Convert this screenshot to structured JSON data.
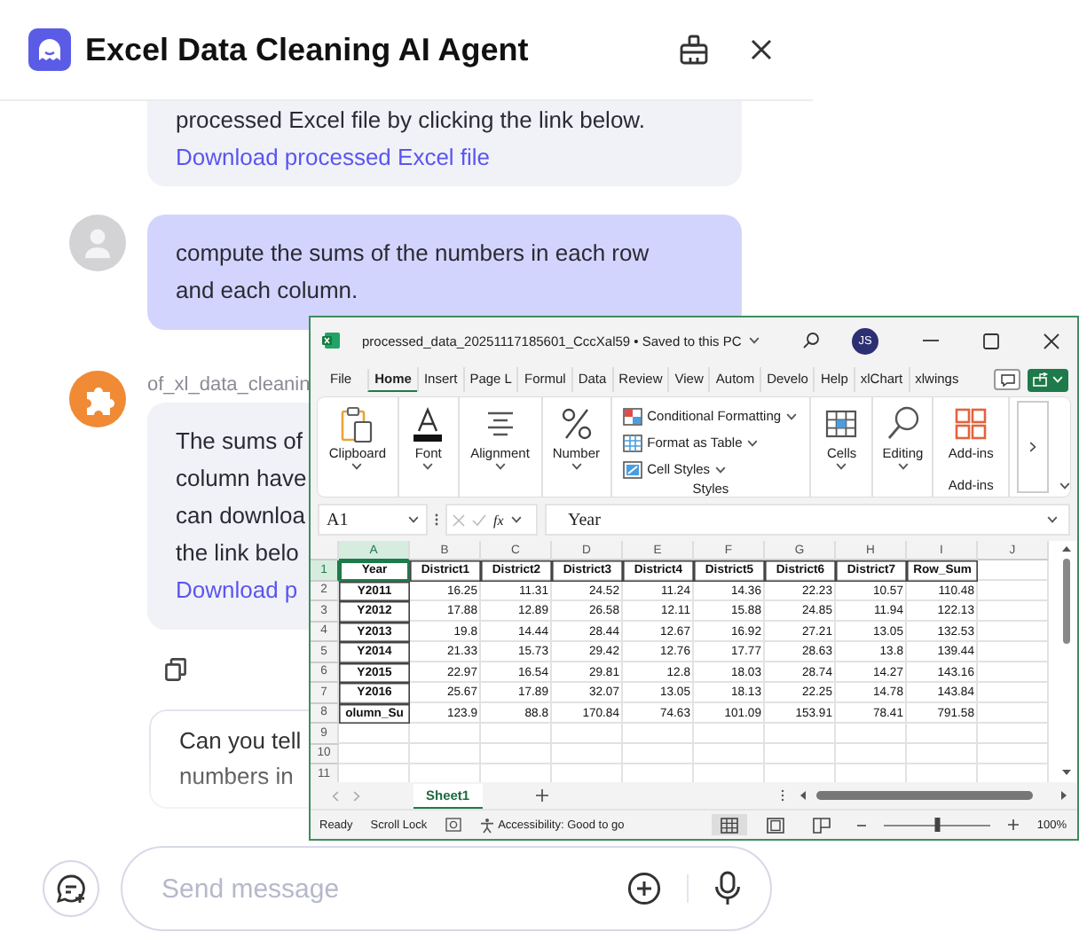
{
  "header": {
    "title": "Excel Data Cleaning AI Agent"
  },
  "messages": [
    {
      "kind": "bot",
      "text": "processed Excel file by clicking the link below.",
      "link": "Download processed Excel file"
    },
    {
      "kind": "user",
      "text": "compute the sums of the numbers in each row\nand each column."
    },
    {
      "kind": "bot",
      "sender": "of_xl_data_cleanin",
      "text": "The sums of\ncolumn have\ncan downloa\nthe link belo",
      "link": "Download p"
    }
  ],
  "suggestion": {
    "text": "Can you tell\nnumbers in"
  },
  "composer": {
    "placeholder": "Send message"
  },
  "excel": {
    "file_title": "processed_data_20251117185601_CccXal59 • Saved to this PC",
    "user_initials": "JS",
    "tabs": [
      {
        "label": "File",
        "selected": false
      },
      {
        "label": "Home",
        "selected": true
      },
      {
        "label": "Insert",
        "selected": false
      },
      {
        "label": "Page L",
        "selected": false
      },
      {
        "label": "Formul",
        "selected": false
      },
      {
        "label": "Data",
        "selected": false
      },
      {
        "label": "Review",
        "selected": false
      },
      {
        "label": "View",
        "selected": false
      },
      {
        "label": "Autom",
        "selected": false
      },
      {
        "label": "Develo",
        "selected": false
      },
      {
        "label": "Help",
        "selected": false
      },
      {
        "label": "xlChart",
        "selected": false
      },
      {
        "label": "xlwings",
        "selected": false
      }
    ],
    "ribbon": [
      {
        "kind": "clipboard",
        "label": "Clipboard"
      },
      {
        "kind": "font",
        "label": "Font"
      },
      {
        "kind": "alignment",
        "label": "Alignment"
      },
      {
        "kind": "number",
        "label": "Number"
      },
      {
        "kind": "styles",
        "group_label": "Styles",
        "items": [
          {
            "kind": "conditional",
            "label": "Conditional Formatting"
          },
          {
            "kind": "table",
            "label": "Format as Table"
          },
          {
            "kind": "cell-styles",
            "label": "Cell Styles"
          }
        ]
      },
      {
        "kind": "cells",
        "label": "Cells"
      },
      {
        "kind": "editing",
        "label": "Editing"
      },
      {
        "kind": "addins",
        "label": "Add-ins",
        "group_label": "Add-ins"
      }
    ],
    "name_box": "A1",
    "formula_label": "fx",
    "formula": "Year",
    "columns": [
      {
        "letter": "A",
        "selected": true
      },
      {
        "letter": "B",
        "selected": false
      },
      {
        "letter": "C",
        "selected": false
      },
      {
        "letter": "D",
        "selected": false
      },
      {
        "letter": "E",
        "selected": false
      },
      {
        "letter": "F",
        "selected": false
      },
      {
        "letter": "G",
        "selected": false
      },
      {
        "letter": "H",
        "selected": false
      },
      {
        "letter": "I",
        "selected": false
      },
      {
        "letter": "J",
        "selected": false
      }
    ],
    "rows": [
      {
        "number": "1",
        "selected": true,
        "cells": [
          "Year",
          "District1",
          "District2",
          "District3",
          "District4",
          "District5",
          "District6",
          "District7",
          "Row_Sum"
        ]
      },
      {
        "number": "2",
        "selected": false,
        "cells": [
          "Y2011",
          "16.25",
          "11.31",
          "24.52",
          "11.24",
          "14.36",
          "22.23",
          "10.57",
          "110.48"
        ]
      },
      {
        "number": "3",
        "selected": false,
        "cells": [
          "Y2012",
          "17.88",
          "12.89",
          "26.58",
          "12.11",
          "15.88",
          "24.85",
          "11.94",
          "122.13"
        ]
      },
      {
        "number": "4",
        "selected": false,
        "cells": [
          "Y2013",
          "19.8",
          "14.44",
          "28.44",
          "12.67",
          "16.92",
          "27.21",
          "13.05",
          "132.53"
        ]
      },
      {
        "number": "5",
        "selected": false,
        "cells": [
          "Y2014",
          "21.33",
          "15.73",
          "29.42",
          "12.76",
          "17.77",
          "28.63",
          "13.8",
          "139.44"
        ]
      },
      {
        "number": "6",
        "selected": false,
        "cells": [
          "Y2015",
          "22.97",
          "16.54",
          "29.81",
          "12.8",
          "18.03",
          "28.74",
          "14.27",
          "143.16"
        ]
      },
      {
        "number": "7",
        "selected": false,
        "cells": [
          "Y2016",
          "25.67",
          "17.89",
          "32.07",
          "13.05",
          "18.13",
          "22.25",
          "14.78",
          "143.84"
        ]
      },
      {
        "number": "8",
        "selected": false,
        "cells": [
          "olumn_Su",
          "123.9",
          "88.8",
          "170.84",
          "74.63",
          "101.09",
          "153.91",
          "78.41",
          "791.58"
        ]
      },
      {
        "number": "9",
        "selected": false
      },
      {
        "number": "10",
        "selected": false
      },
      {
        "number": "11",
        "selected": false
      }
    ],
    "sheet_tabs": [
      {
        "label": "Sheet1",
        "selected": true
      }
    ],
    "status": {
      "mode": "Ready",
      "scroll_lock": "Scroll Lock",
      "accessibility": "Accessibility: Good to go",
      "views": [
        {
          "kind": "normal",
          "selected": true
        },
        {
          "kind": "page-layout",
          "selected": false
        },
        {
          "kind": "page-break",
          "selected": false
        }
      ],
      "zoom": {
        "level": 0.5,
        "reading": "100%"
      }
    }
  }
}
